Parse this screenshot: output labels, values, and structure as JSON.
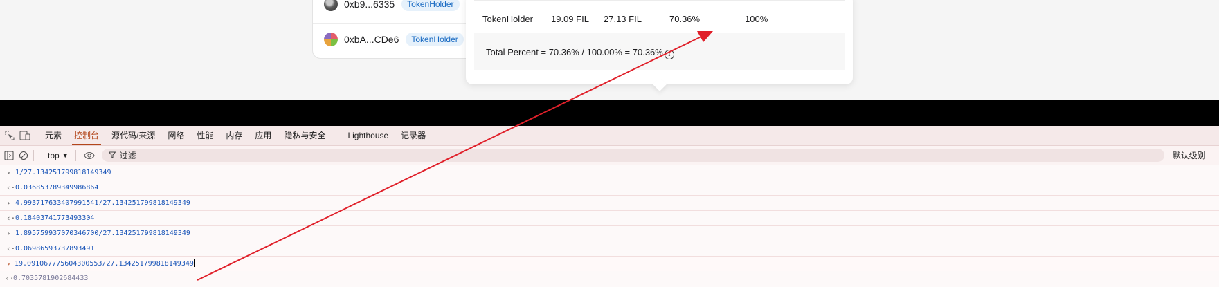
{
  "holders": [
    {
      "address": "0xb9...6335",
      "tag": "TokenHolder"
    },
    {
      "address": "0xbA...CDe6",
      "tag": "TokenHolder"
    }
  ],
  "popup": {
    "row": {
      "type": "TokenHolder",
      "amount": "19.09 FIL",
      "total": "27.13 FIL",
      "percent": "70.36%",
      "weight": "100%"
    },
    "total_percent": "Total Percent = 70.36% / 100.00% = 70.36%"
  },
  "devtools": {
    "tabs": [
      "元素",
      "控制台",
      "源代码/来源",
      "网络",
      "性能",
      "内存",
      "应用",
      "隐私与安全",
      "Lighthouse",
      "记录器"
    ],
    "active_tab": "控制台",
    "context": "top",
    "filter_placeholder": "过滤",
    "log_level": "默认级别",
    "console_lines": [
      {
        "kind": "input",
        "text": "1/27.134251799818149349"
      },
      {
        "kind": "output",
        "text": "0.036853789349986864"
      },
      {
        "kind": "input",
        "text": "4.993717633407991541/27.134251799818149349"
      },
      {
        "kind": "output",
        "text": "0.18403741773493304"
      },
      {
        "kind": "input",
        "text": "1.895759937070346700/27.134251799818149349"
      },
      {
        "kind": "output",
        "text": "0.06986593737893491"
      }
    ],
    "prompt_text": "19.091067775604300553/27.134251799818149349",
    "preview_text": "0.7035781902684433"
  },
  "colors": {
    "annotation_arrow": "#e0202a",
    "active_tab": "#b3461b",
    "console_value": "#1a55b8"
  }
}
